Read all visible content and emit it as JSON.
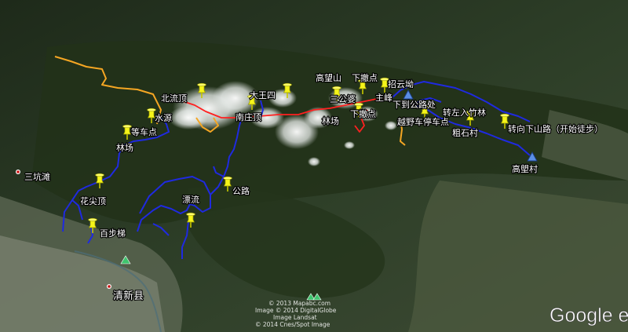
{
  "labels": {
    "beiliuding": "北流顶",
    "shuiyuan": "水源",
    "dengchedian_w": "等车点",
    "linchang_w": "林场",
    "huajianding": "花尖顶",
    "baibuti": "百步梯",
    "piaoliu": "漂流",
    "gonglu": "公路",
    "dawangsi": "大王四",
    "nanzhuangding": "南庄顶",
    "gaowangshan": "高望山",
    "xiachedian_top": "下撤点",
    "zhaoyunao": "招云坳",
    "sangongpo": "三公婆",
    "zhufeng": "主峰",
    "linchang_e": "林场",
    "xiachedian_mid": "下撤点",
    "xiadao_gonglu": "下到公路处",
    "zhuanzuo": "转左入竹林",
    "yueye": "越野车停车点",
    "cushicun": "粗石村",
    "zhuanxiang": "转向下山路（开始徒步）",
    "gaowangcun": "高塱村",
    "sankengtan": "三坑滩",
    "qingxinxian": "清新县"
  },
  "credits": {
    "line1": "© 2013 Mapabc.com",
    "line2": "Image © 2014 DigitalGlobe",
    "line3": "Image Landsat",
    "line4": "© 2014 Cnes/Spot Image",
    "brand": "Google e"
  },
  "colors": {
    "blue_route": "#1f2ae0",
    "orange_route": "#f5a623",
    "red_route": "#ff2020",
    "pin_yellow": "#f5f51a",
    "marker_blue": "#5b8fe6",
    "terrain": "#2c3a26"
  }
}
